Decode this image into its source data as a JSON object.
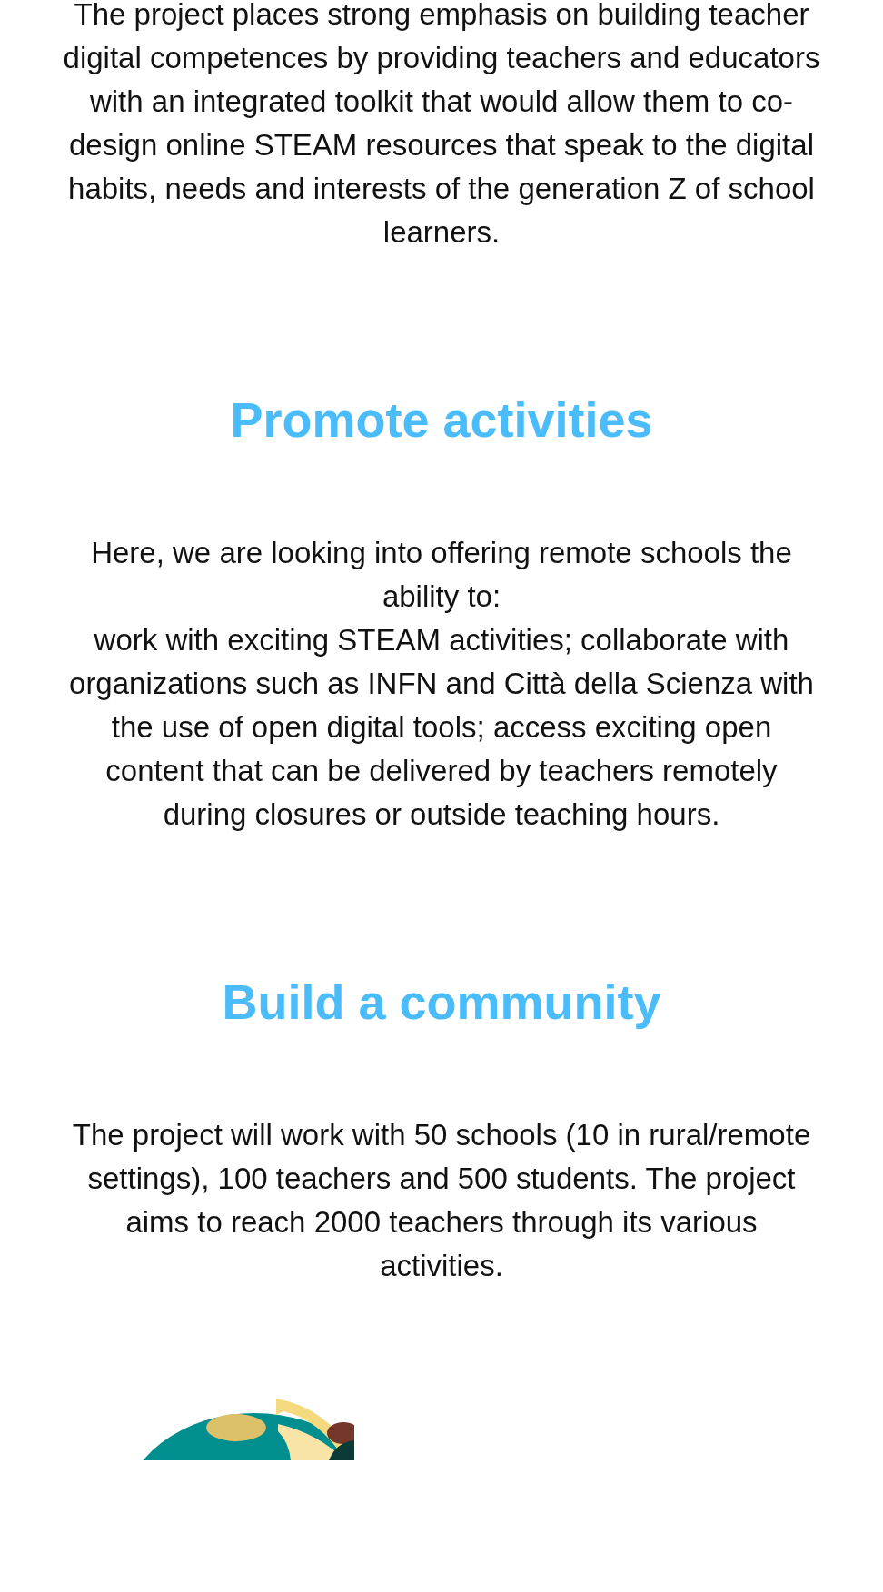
{
  "sections": [
    {
      "paragraphs": [
        "The project places strong emphasis on building teacher digital competences by providing teachers and educators with an integrated toolkit that would allow them to co-design online STEAM resources that speak to the digital habits, needs and interests of the generation Z of school learners."
      ]
    },
    {
      "heading": "Promote activities",
      "paragraphs": [
        "Here, we are looking into offering remote schools the ability to:",
        "work with exciting STEAM activities; collaborate with organizations such as INFN and Città della Scienza with the use of open digital tools; access exciting open content that can be delivered by teachers remotely during closures or outside teaching hours."
      ]
    },
    {
      "heading": "Build a community",
      "paragraphs": [
        "The project will work with 50 schools (10 in rural/remote settings), 100 teachers and 500 students. The project aims to reach 2000 teachers through its various activities."
      ]
    }
  ]
}
